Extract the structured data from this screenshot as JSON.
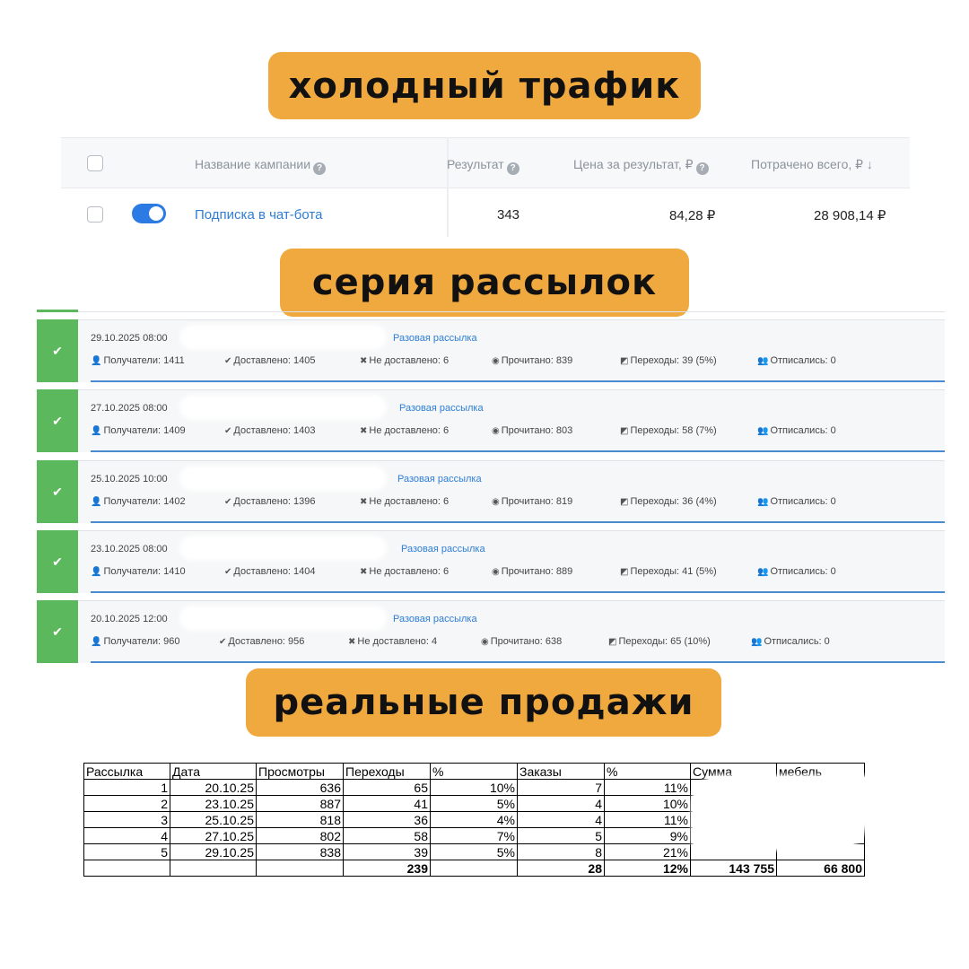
{
  "headings": {
    "cold_traffic": "холодный трафик",
    "mail_series": "серия рассылок",
    "real_sales": "реальные продажи"
  },
  "ads_table": {
    "headers": {
      "campaign_name": "Название кампании",
      "result": "Результат",
      "cost_per_result": "Цена за результат, ₽",
      "spent_total": "Потрачено всего, ₽ ↓"
    },
    "row": {
      "campaign": "Подписка в чат-бота",
      "result": "343",
      "cost_per_result": "84,28 ₽",
      "spent_total": "28 908,14 ₽",
      "active": true
    }
  },
  "mailings": [
    {
      "date": "29.10.2025 08:00",
      "type": "Разовая рассылка",
      "recipients": "Получатели: 1411",
      "delivered": "Доставлено: 1405",
      "not_delivered": "Не доставлено: 6",
      "read": "Прочитано: 839",
      "clicks": "Переходы: 39 (5%)",
      "unsubscribed": "Отписались: 0"
    },
    {
      "date": "27.10.2025 08:00",
      "type": "Разовая рассылка",
      "recipients": "Получатели: 1409",
      "delivered": "Доставлено: 1403",
      "not_delivered": "Не доставлено: 6",
      "read": "Прочитано: 803",
      "clicks": "Переходы: 58 (7%)",
      "unsubscribed": "Отписались: 0"
    },
    {
      "date": "25.10.2025 10:00",
      "type": "Разовая рассылка",
      "recipients": "Получатели: 1402",
      "delivered": "Доставлено: 1396",
      "not_delivered": "Не доставлено: 6",
      "read": "Прочитано: 819",
      "clicks": "Переходы: 36 (4%)",
      "unsubscribed": "Отписались: 0"
    },
    {
      "date": "23.10.2025 08:00",
      "type": "Разовая рассылка",
      "recipients": "Получатели: 1410",
      "delivered": "Доставлено: 1404",
      "not_delivered": "Не доставлено: 6",
      "read": "Прочитано: 889",
      "clicks": "Переходы: 41 (5%)",
      "unsubscribed": "Отписались: 0"
    },
    {
      "date": "20.10.2025 12:00",
      "type": "Разовая рассылка",
      "recipients": "Получатели: 960",
      "delivered": "Доставлено: 956",
      "not_delivered": "Не доставлено: 4",
      "read": "Прочитано: 638",
      "clicks": "Переходы: 65 (10%)",
      "unsubscribed": "Отписались: 0"
    }
  ],
  "sales_sheet": {
    "headers": [
      "Рассылка",
      "Дата",
      "Просмотры",
      "Переходы",
      "%",
      "Заказы",
      "%",
      "Сумма",
      "мебель"
    ],
    "rows": [
      [
        "1",
        "20.10.25",
        "636",
        "65",
        "10%",
        "7",
        "11%",
        "",
        ""
      ],
      [
        "2",
        "23.10.25",
        "887",
        "41",
        "5%",
        "4",
        "10%",
        "",
        ""
      ],
      [
        "3",
        "25.10.25",
        "818",
        "36",
        "4%",
        "4",
        "11%",
        "",
        ""
      ],
      [
        "4",
        "27.10.25",
        "802",
        "58",
        "7%",
        "5",
        "9%",
        "",
        ""
      ],
      [
        "5",
        "29.10.25",
        "838",
        "39",
        "5%",
        "8",
        "21%",
        "",
        ""
      ]
    ],
    "totals": [
      "",
      "",
      "",
      "239",
      "",
      "28",
      "12%",
      "143 755",
      "66 800"
    ]
  }
}
